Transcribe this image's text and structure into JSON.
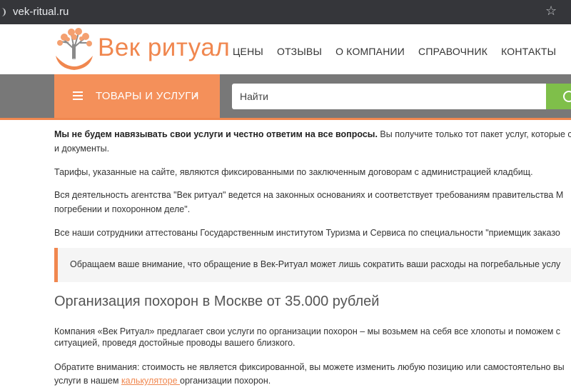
{
  "browser": {
    "url": "vek-ritual.ru",
    "bookmark_icon": "star-icon"
  },
  "header": {
    "logo_text": "Век ритуал",
    "logo_icon": "tree-logo-icon",
    "nav": [
      "ЦЕНЫ",
      "ОТЗЫВЫ",
      "О КОМПАНИИ",
      "СПРАВОЧНИК",
      "КОНТАКТЫ"
    ]
  },
  "toolbar": {
    "catalog_label": "ТОВАРЫ И УСЛУГИ",
    "search_placeholder": "Найти",
    "accent_color": "#f0874f",
    "search_button_color": "#7fbf4a"
  },
  "content": {
    "intro_bold": "Мы не будем навязывать свои услуги и честно ответим на все вопросы.",
    "intro_rest": " Вы получите только тот пакет услуг, которые со",
    "intro_line2": "и документы.",
    "tariffs": "Тарифы, указанные на сайте, являются фиксированными по заключенным договорам с администрацией кладбищ.",
    "legal_line1": "Вся деятельность агентства \"Век ритуал\" ведется на законных основаниях и соответствует требованиям правительства М",
    "legal_line2": "погребении и похоронном деле\".",
    "staff": "Все наши сотрудники аттестованы Государственным институтом Туризма и Сервиса по специальности \"приемщик заказо",
    "notice": "Обращаем ваше внимание, что обращение в Век-Ритуал может лишь сократить ваши расходы на погребальные услу",
    "heading": "Организация похорон в Москве от 35.000 рублей",
    "company_line1": "Компания «Век Ритуал» предлагает свои услуги по организации похорон – мы возьмем на себя все хлопоты и поможем с",
    "company_line2": "ситуацией, проведя достойные проводы вашего близкого.",
    "cost_line1": "Обратите внимания: стоимость не является фиксированной, вы можете изменить любую позицию или самостоятельно вы",
    "cost_line2_before": "услуги в нашем ",
    "cost_link": "калькуляторе ",
    "cost_line2_after": "организации похорон."
  }
}
